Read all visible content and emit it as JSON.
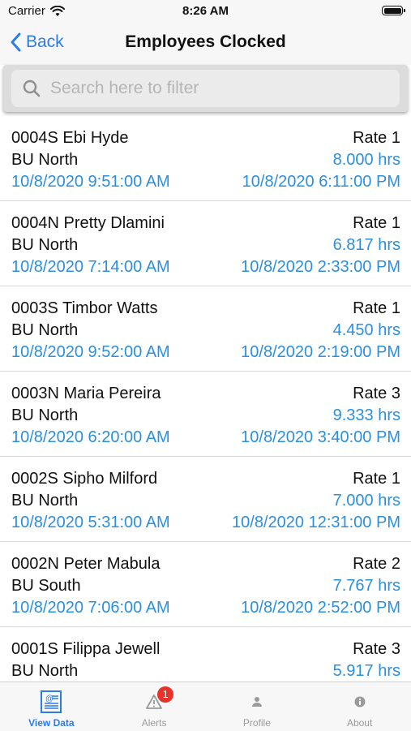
{
  "status_bar": {
    "carrier": "Carrier",
    "time": "8:26 AM"
  },
  "nav": {
    "back_label": "Back",
    "title": "Employees Clocked"
  },
  "search": {
    "placeholder": "Search here to filter"
  },
  "employees": [
    {
      "name": "0004S Ebi Hyde",
      "rate": "Rate 1",
      "unit": "BU North",
      "hours": "8.000 hrs",
      "start": "10/8/2020 9:51:00 AM",
      "end": "10/8/2020 6:11:00 PM"
    },
    {
      "name": "0004N Pretty Dlamini",
      "rate": "Rate 1",
      "unit": "BU North",
      "hours": "6.817 hrs",
      "start": "10/8/2020 7:14:00 AM",
      "end": "10/8/2020 2:33:00 PM"
    },
    {
      "name": "0003S Timbor Watts",
      "rate": "Rate 1",
      "unit": "BU North",
      "hours": "4.450 hrs",
      "start": "10/8/2020 9:52:00 AM",
      "end": "10/8/2020 2:19:00 PM"
    },
    {
      "name": "0003N Maria Pereira",
      "rate": "Rate 3",
      "unit": "BU North",
      "hours": "9.333 hrs",
      "start": "10/8/2020 6:20:00 AM",
      "end": "10/8/2020 3:40:00 PM"
    },
    {
      "name": "0002S Sipho Milford",
      "rate": "Rate 1",
      "unit": "BU North",
      "hours": "7.000 hrs",
      "start": "10/8/2020 5:31:00 AM",
      "end": "10/8/2020 12:31:00 PM"
    },
    {
      "name": "0002N Peter Mabula",
      "rate": "Rate 2",
      "unit": "BU South",
      "hours": "7.767 hrs",
      "start": "10/8/2020 7:06:00 AM",
      "end": "10/8/2020 2:52:00 PM"
    },
    {
      "name": "0001S Filippa Jewell",
      "rate": "Rate 3",
      "unit": "BU North",
      "hours": "5.917 hrs",
      "start": "",
      "end": ""
    }
  ],
  "tabs": [
    {
      "label": "View Data",
      "icon": "view-data-icon",
      "active": true
    },
    {
      "label": "Alerts",
      "icon": "alert-icon",
      "badge": "1"
    },
    {
      "label": "Profile",
      "icon": "profile-icon"
    },
    {
      "label": "About",
      "icon": "info-icon"
    }
  ],
  "colors": {
    "accent": "#2b7de9",
    "value_blue": "#2b8fe0",
    "badge": "#e8322a"
  }
}
